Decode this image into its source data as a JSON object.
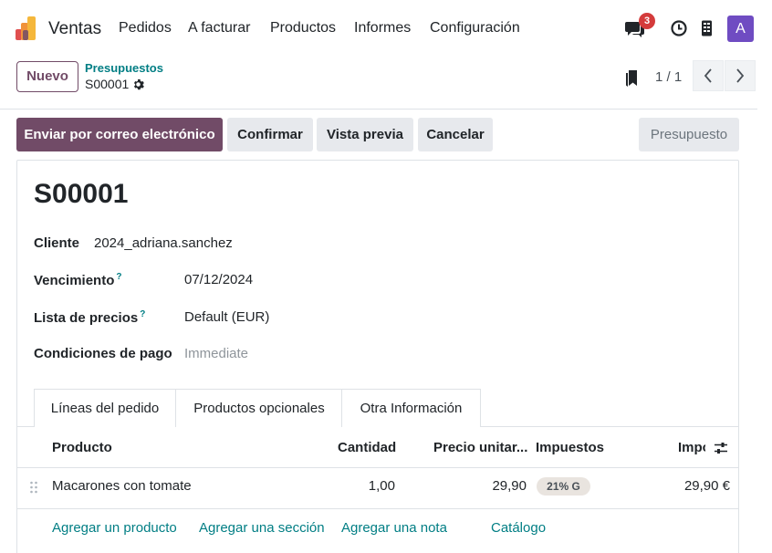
{
  "navbar": {
    "app_name": "Ventas",
    "menus": [
      "Pedidos",
      "A facturar",
      "Productos",
      "Informes",
      "Configuración"
    ],
    "chat_badge": "3",
    "avatar_initial": "A",
    "icons": [
      "chat-icon",
      "clock-icon",
      "phone-icon"
    ]
  },
  "control": {
    "new_button": "Nuevo",
    "breadcrumb_parent": "Presupuestos",
    "breadcrumb_current": "S00001",
    "pager": "1 / 1"
  },
  "actions": {
    "send_email": "Enviar por correo electrónico",
    "confirm": "Confirmar",
    "preview": "Vista previa",
    "cancel": "Cancelar",
    "status": "Presupuesto"
  },
  "form": {
    "title": "S00001",
    "customer_label": "Cliente",
    "customer_value": "2024_adriana.sanchez",
    "expiry_label": "Vencimiento",
    "expiry_value": "07/12/2024",
    "pricelist_label": "Lista de precios",
    "pricelist_value": "Default (EUR)",
    "payment_terms_label": "Condiciones de pago",
    "payment_terms_value": "Immediate",
    "help_mark": "?"
  },
  "tabs": [
    "Líneas del pedido",
    "Productos opcionales",
    "Otra Información"
  ],
  "table": {
    "headers": {
      "product": "Producto",
      "quantity": "Cantidad",
      "unit_price": "Precio unitar...",
      "taxes": "Impuestos",
      "amount": "Impo"
    },
    "rows": [
      {
        "product": "Macarones con tomate",
        "quantity": "1,00",
        "unit_price": "29,90",
        "tax": "21% G",
        "amount": "29,90 €"
      }
    ],
    "links": [
      "Agregar un producto",
      "Agregar una sección",
      "Agregar una nota",
      "Catálogo"
    ]
  },
  "colors": {
    "primary": "#714b67",
    "link": "#017e84",
    "badge": "#d43b3b",
    "avatar": "#6f4cc2"
  }
}
